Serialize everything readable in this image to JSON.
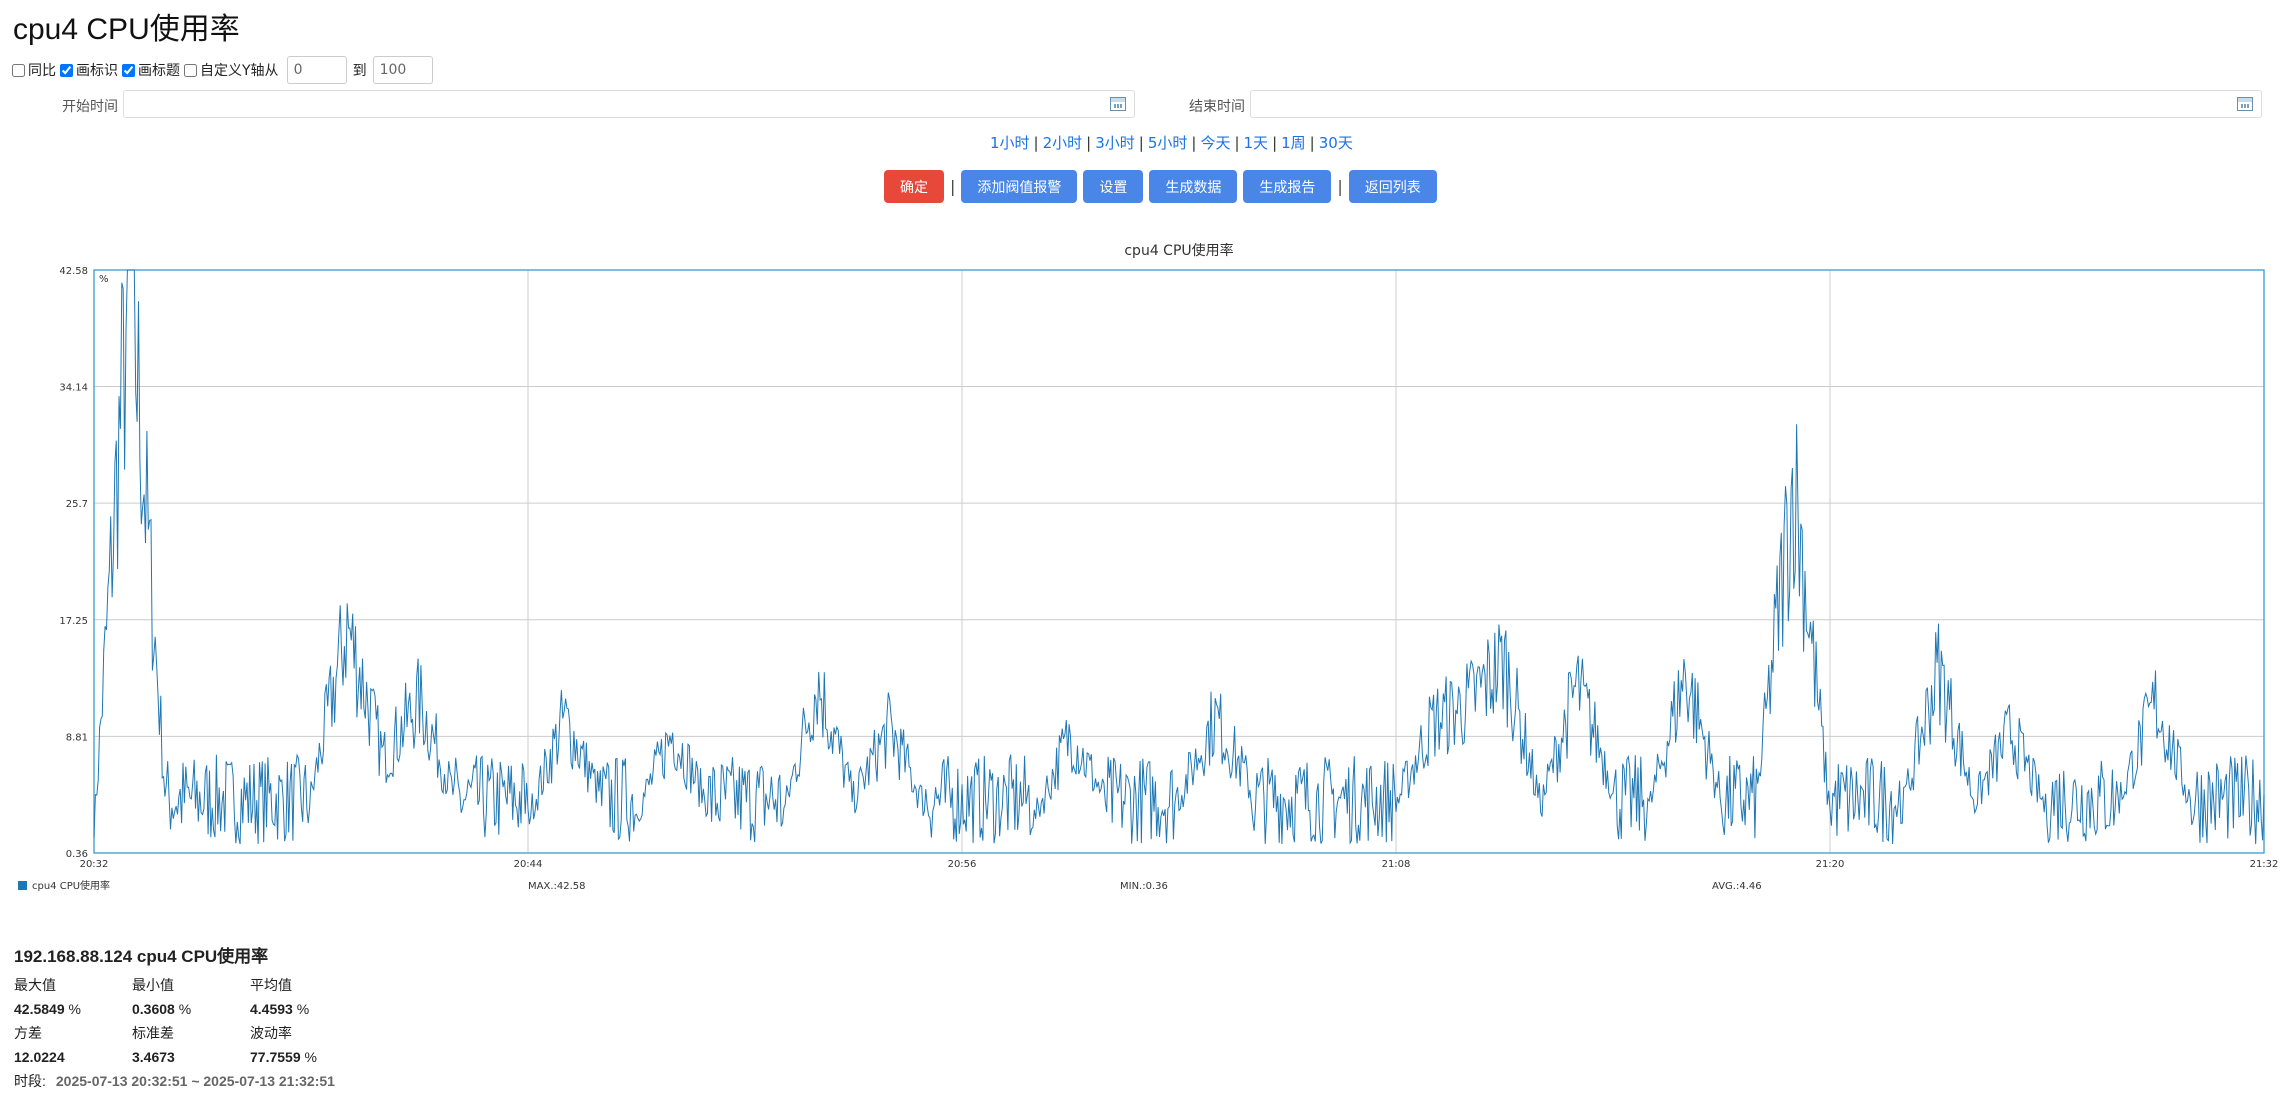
{
  "page": {
    "title": "cpu4 CPU使用率"
  },
  "options": {
    "yoy_label": "同比",
    "yoy_checked": false,
    "mark_label": "画标识",
    "mark_checked": true,
    "title_label": "画标题",
    "title_checked": true,
    "custom_y_label": "自定义Y轴从",
    "custom_y_checked": false,
    "y_from": "0",
    "to_label": "到",
    "y_to": "100"
  },
  "time": {
    "start_label": "开始时间",
    "start_value": "",
    "end_label": "结束时间",
    "end_value": ""
  },
  "quick_ranges": [
    "1小时",
    "2小时",
    "3小时",
    "5小时",
    "今天",
    "1天",
    "1周",
    "30天"
  ],
  "buttons": {
    "confirm": "确定",
    "add_alarm": "添加阀值报警",
    "settings": "设置",
    "gen_data": "生成数据",
    "gen_report": "生成报告",
    "back": "返回列表"
  },
  "colors": {
    "line": "#1f77b4",
    "confirm": "#e8483a",
    "primary": "#4a86e8",
    "link": "#1a73e8"
  },
  "chart_data": {
    "type": "line",
    "title": "cpu4 CPU使用率",
    "unit": "%",
    "x_ticks": [
      "20:32",
      "20:44",
      "20:56",
      "21:08",
      "21:20",
      "21:32"
    ],
    "y_ticks": [
      0.36,
      8.81,
      17.25,
      25.7,
      34.14,
      42.58
    ],
    "ylim": [
      0.36,
      42.58
    ],
    "x_range": [
      "20:32",
      "21:32"
    ],
    "grid": true,
    "legend": "bottom-left",
    "series": [
      {
        "name": "cpu4 CPU使用率",
        "color": "#1f77b4",
        "x": [
          "20:32",
          "20:33",
          "20:34",
          "20:35",
          "20:36",
          "20:37",
          "20:38",
          "20:39",
          "20:40",
          "20:41",
          "20:42",
          "20:43",
          "20:44",
          "20:45",
          "20:46",
          "20:47",
          "20:48",
          "20:49",
          "20:50",
          "20:51",
          "20:52",
          "20:53",
          "20:54",
          "20:55",
          "20:56",
          "20:57",
          "20:58",
          "20:59",
          "21:00",
          "21:01",
          "21:02",
          "21:03",
          "21:04",
          "21:05",
          "21:06",
          "21:07",
          "21:08",
          "21:09",
          "21:10",
          "21:11",
          "21:12",
          "21:13",
          "21:14",
          "21:15",
          "21:16",
          "21:17",
          "21:18",
          "21:19",
          "21:20",
          "21:21",
          "21:22",
          "21:23",
          "21:24",
          "21:25",
          "21:26",
          "21:27",
          "21:28",
          "21:29",
          "21:30",
          "21:31",
          "21:32"
        ],
        "values": [
          2.1,
          42.58,
          3.4,
          5.2,
          2.8,
          3.1,
          4.5,
          16.8,
          7.2,
          11.4,
          4.2,
          3.5,
          2.9,
          10.1,
          4.6,
          3.2,
          9.1,
          3.8,
          3.0,
          2.6,
          12.8,
          4.3,
          9.5,
          3.6,
          2.8,
          3.4,
          2.9,
          9.0,
          4.1,
          3.6,
          4.4,
          10.2,
          5.1,
          6.3,
          4.8,
          4.2,
          3.9,
          9.8,
          11.2,
          14.3,
          3.8,
          12.5,
          5.4,
          3.6,
          13.4,
          4.2,
          4.9,
          27.6,
          3.2,
          4.5,
          3.6,
          13.8,
          4.1,
          9.2,
          3.4,
          5.6,
          4.3,
          11.2,
          4.0,
          5.2,
          4.6
        ],
        "max": "MAX.:42.58",
        "min": "MIN.:0.36",
        "avg": "AVG.:4.46"
      }
    ]
  },
  "stats": {
    "heading": "192.168.88.124 cpu4 CPU使用率",
    "max_label": "最大值",
    "min_label": "最小值",
    "avg_label": "平均值",
    "max_value": "42.5849",
    "min_value": "0.3608",
    "avg_value": "4.4593",
    "percent": "%",
    "var_label": "方差",
    "std_label": "标准差",
    "vol_label": "波动率",
    "var_value": "12.0224",
    "std_value": "3.4673",
    "vol_value": "77.7559",
    "period_label": "时段:",
    "period_value": "2025-07-13 20:32:51 ~ 2025-07-13 21:32:51"
  }
}
